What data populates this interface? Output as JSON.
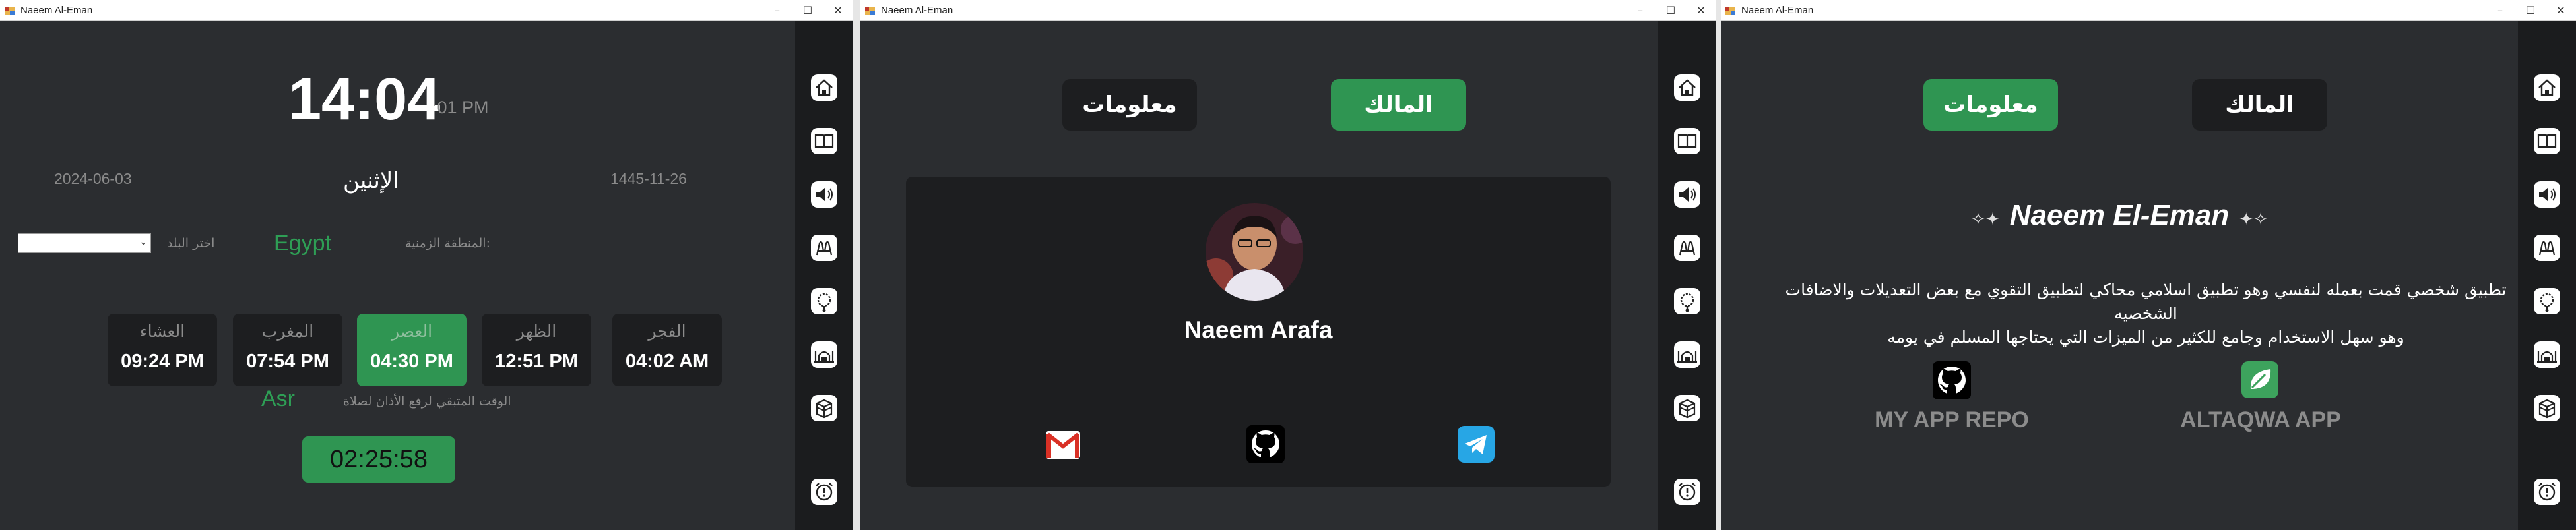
{
  "app": {
    "title": "Naeem Al-Eman"
  },
  "window1": {
    "time": "14:04",
    "seconds_ampm": ":01 PM",
    "date_gregorian": "2024-06-03",
    "day_name": "الإثنين",
    "date_hijri": "1445-11-26",
    "country_select_label": "اختر البلد",
    "country_select_value": "",
    "timezone_label": "المنطقة الزمنية:",
    "country": "Egypt",
    "prayers": [
      {
        "name": "الفجر",
        "time": "04:02 AM"
      },
      {
        "name": "الظهر",
        "time": "12:51 PM"
      },
      {
        "name": "العصر",
        "time": "04:30 PM",
        "active": true
      },
      {
        "name": "المغرب",
        "time": "07:54 PM"
      },
      {
        "name": "العشاء",
        "time": "09:24 PM"
      }
    ],
    "remaining_label": "الوقت المتبقي لرفع الأذان لصلاة",
    "next_prayer": "Asr",
    "countdown": "02:25:58"
  },
  "window2": {
    "tab_owner": "المالك",
    "tab_info": "معلومات",
    "owner_name": "Naeem Arafa"
  },
  "window3": {
    "tab_info": "معلومات",
    "tab_owner": "المالك",
    "heading": "Naeem El-Eman",
    "description_line1": "تطبيق شخصي قمت بعمله لنفسي وهو تطبيق اسلامي محاكي لتطبيق التقوي مع  بعض التعديلات والاضافات الشخصيه",
    "description_line2": "وهو سهل الاستخدام وجامع للكثير من الميزات التي يحتاجها المسلم في يومه",
    "repo_label": "MY APP REPO",
    "altaqwa_label": "ALTAQWA APP"
  },
  "colors": {
    "accent_green": "#2f9552",
    "bg": "#2b2d30",
    "card": "#1d1e20",
    "sidebar": "#1b1c1e"
  },
  "sidebar_icons": [
    "home-icon",
    "book-icon",
    "speaker-icon",
    "praying-hands-icon",
    "prayer-beads-icon",
    "mosque-icon",
    "kaaba-icon",
    "alarm-icon"
  ]
}
